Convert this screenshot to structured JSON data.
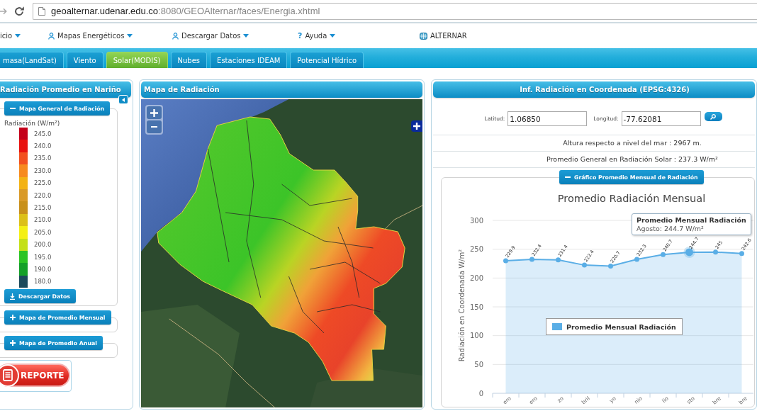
{
  "browser": {
    "url_host": "geoalternar.udenar.edu.co",
    "url_path": ":8080/GEOAlternar/faces/Energia.xhtml"
  },
  "menu": [
    {
      "kind": "plain",
      "label": "icio",
      "dropdown": true
    },
    {
      "kind": "user",
      "label": "Mapas Energéticos",
      "dropdown": true
    },
    {
      "kind": "user",
      "label": "Descargar Datos",
      "dropdown": true
    },
    {
      "kind": "help",
      "icon_text": "?",
      "label": "Ayuda",
      "dropdown": true
    },
    {
      "kind": "grid",
      "label": "ALTERNAR",
      "dropdown": false
    }
  ],
  "tabs": [
    {
      "label": "masa(LandSat)",
      "selected": false
    },
    {
      "label": "Viento",
      "selected": false
    },
    {
      "label": "Solar(MODIS)",
      "selected": true
    },
    {
      "label": "Nubes",
      "selected": false
    },
    {
      "label": "Estaciones IDEAM",
      "selected": false
    },
    {
      "label": "Potencial Hídrico",
      "selected": false
    }
  ],
  "left_panel": {
    "title": "Radiación Promedio en Nariño",
    "sections": [
      {
        "label": "Mapa General de Radiación",
        "expanded": true,
        "scale": {
          "title": "Radiación (W/m²)",
          "stops": [
            {
              "label": "245.0",
              "color": "#c4001a"
            },
            {
              "label": "240.0",
              "color": "#e8120e"
            },
            {
              "label": "235.0",
              "color": "#f2501e"
            },
            {
              "label": "230.0",
              "color": "#f78a1e"
            },
            {
              "label": "225.0",
              "color": "#f3b214"
            },
            {
              "label": "220.0",
              "color": "#d99a28"
            },
            {
              "label": "215.0",
              "color": "#c8901a"
            },
            {
              "label": "210.0",
              "color": "#dcc018"
            },
            {
              "label": "205.0",
              "color": "#f4f014"
            },
            {
              "label": "200.0",
              "color": "#c4e018"
            },
            {
              "label": "195.0",
              "color": "#2cc424"
            },
            {
              "label": "190.0",
              "color": "#14a028"
            },
            {
              "label": "180.0",
              "color": "#1c4a5c"
            }
          ]
        },
        "download_button": "Descargar Datos"
      },
      {
        "label": "Mapa de Promedio Mensual",
        "expanded": false
      },
      {
        "label": "Mapa de Promedio Anual",
        "expanded": false
      }
    ],
    "report_button": "REPORTE"
  },
  "map_panel": {
    "title": "Mapa de Radiación"
  },
  "right_panel": {
    "title": "Inf. Radiación en Coordenada (EPSG:4326)",
    "latitude": {
      "label": "Latitud:",
      "value": "1.06850"
    },
    "longitude": {
      "label": "Longitud:",
      "value": "-77.62081"
    },
    "info_rows": [
      "Altura respecto a nivel del mar : 2967 m.",
      "Promedio General en Radiación Solar : 237.3 W/m²"
    ],
    "chart_section": {
      "label": "Gráfico Promedio Mensual de Radiación",
      "expanded": true,
      "chart_data": {
        "type": "area",
        "title": "Promedio Radiación Mensual",
        "ylabel": "Radiación en Coordenada W/m²",
        "categories": [
          "ero",
          "ero",
          "zo",
          "bril",
          "yo",
          "nio",
          "lio",
          "sto",
          "bre",
          "bre"
        ],
        "series": [
          {
            "name": "Promedio Mensual Radiación",
            "color": "#5aaee6",
            "values": [
              229.9,
              232.4,
              231.4,
              222.4,
              220.7,
              232.3,
              240.7,
              244.7,
              245,
              242.6
            ]
          }
        ],
        "ylim": [
          0,
          300
        ],
        "yticks": [
          0,
          50,
          100,
          150,
          200,
          250,
          300
        ],
        "grid": true,
        "data_labels": true
      },
      "points": [
        {
          "selected": false
        },
        {
          "selected": false
        },
        {
          "selected": false
        },
        {
          "selected": false
        },
        {
          "selected": false
        },
        {
          "selected": false
        },
        {
          "selected": false
        },
        {
          "selected": true
        },
        {
          "selected": false
        },
        {
          "selected": false
        }
      ],
      "tooltip": {
        "title": "Promedio Mensual Radiación",
        "text": "Agosto: 244.7 W/m²"
      }
    }
  }
}
